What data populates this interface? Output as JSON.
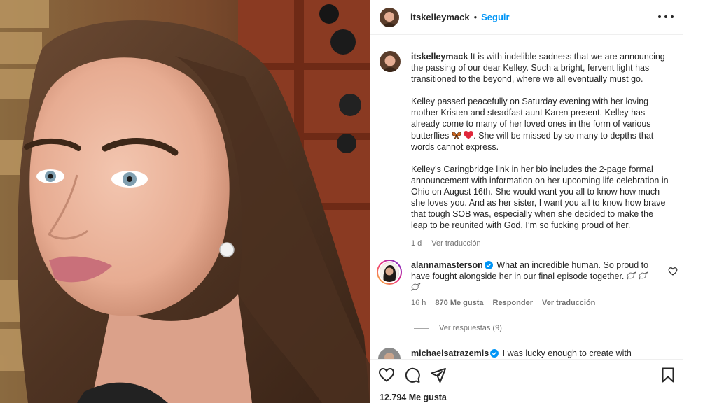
{
  "post": {
    "username": "itskelleymack",
    "separator": "•",
    "follow_label": "Seguir",
    "caption_paragraphs": [
      "It is with indelible sadness that we are announcing the passing of our dear Kelley. Such a bright, fervent light has transitioned to the beyond, where we all eventually must go.",
      "Kelley passed peacefully on Saturday evening with her loving mother Kristen and steadfast aunt Karen present. Kelley has already come to many of her loved ones in the form of various butterflies",
      "Kelley’s Caringbridge link in her bio includes the 2-page formal announcement with information on her upcoming life celebration in Ohio on August 16th. She would want you all to know how much she loves you. And as her sister, I want you all to know how brave that tough SOB was, especially when she decided to make the leap to be reunited with God. I’m so fucking proud of her."
    ],
    "caption_after_emoji": ". She will be missed by so many to depths that words cannot express.",
    "time_ago": "1 d",
    "translate_label": "Ver traducción",
    "likes_count": "12.794 Me gusta",
    "icons": [
      "heart-icon",
      "comment-icon",
      "share-icon",
      "bookmark-icon",
      "more-icon",
      "verified-icon"
    ]
  },
  "comments": [
    {
      "username": "alannamasterson",
      "text": "What an incredible human. So proud to have fought alongside her in our final episode together.",
      "time_ago": "16 h",
      "likes": "870 Me gusta",
      "reply_label": "Responder",
      "translate_label": "Ver traducción",
      "view_replies_label": "Ver respuestas (9)"
    },
    {
      "username": "michaelsatrazemis",
      "text": "I was lucky enough to create with Kelley"
    }
  ],
  "colors": {
    "accent": "#0095f6",
    "text": "#262626",
    "secondary": "#737373",
    "border": "#efefef",
    "heart_red": "#e0263a",
    "butterfly": "#c8641e"
  }
}
